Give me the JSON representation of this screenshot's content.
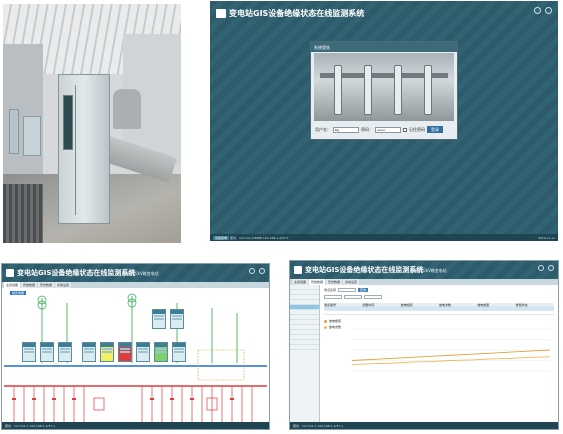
{
  "login": {
    "title": "变电站GIS设备绝缘状态在线监测系统",
    "box_title": "系统登陆",
    "username_label": "用户名：",
    "username_value": "ktg",
    "password_label": "密码：",
    "password_value": "••••••••",
    "remember_label": "记住密码",
    "login_button": "登录",
    "status_start": "系统菜单",
    "status_text": "服务：127.0.0.1:8888 192.168.1.4/37.1",
    "status_right": "2019-xx-xx"
  },
  "diagram": {
    "title": "变电站GIS设备绝缘状态在线监测系统",
    "subtitle": "国网110kV输变电站",
    "tabs": [
      "主接线图",
      "局放数据",
      "历史数据",
      "系统设置"
    ],
    "badge": "组合电器",
    "status_text": "服务：127.0.0.1 192.168.1.4/37.1"
  },
  "trend": {
    "title": "变电站GIS设备绝缘状态在线监测系统",
    "subtitle": "国网110kV输变电站",
    "tabs": [
      "主接线图",
      "局放数据",
      "历史数据",
      "系统设置"
    ],
    "filter_label": "测点名称",
    "query_button": "查询",
    "table_headers": [
      "测点编号",
      "测量时间",
      "放电幅值",
      "放电次数",
      "放电类型",
      "告警状态"
    ],
    "series_names": [
      "放电幅值",
      "放电次数"
    ],
    "series_colors": [
      "#e0a13a",
      "#f0b85a"
    ],
    "status_text": "服务：127.0.0.1 192.168.1.4/37.1"
  },
  "colors": {
    "header_teal": "#2d5b6b",
    "accent_blue": "#2d78c4",
    "alarm_red": "#e23b3b",
    "warn_yellow": "#f1f060",
    "ok_green": "#7dd36b"
  },
  "chart_data": {
    "type": "line",
    "x": [
      0,
      1,
      2,
      3,
      4,
      5,
      6,
      7,
      8,
      9,
      10
    ],
    "series": [
      {
        "name": "放电幅值",
        "values": [
          10,
          11,
          12,
          13,
          14,
          15,
          16,
          17,
          18,
          19,
          20
        ]
      },
      {
        "name": "放电次数",
        "values": [
          6,
          7,
          7.5,
          8.5,
          9,
          10,
          10.5,
          11.5,
          12,
          13,
          13.5
        ]
      }
    ],
    "ylim": [
      0,
      40
    ],
    "grid": true
  }
}
